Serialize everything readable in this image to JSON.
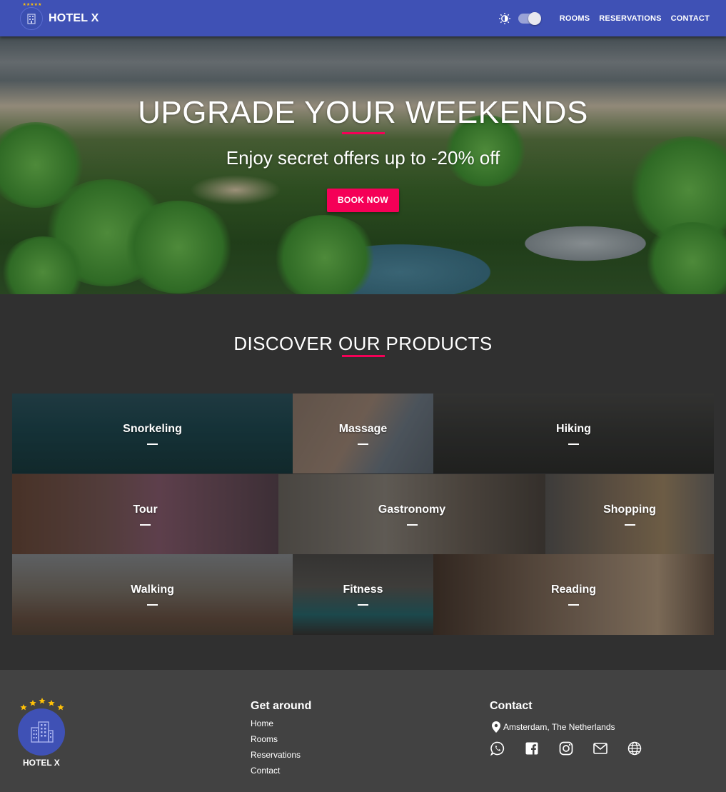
{
  "nav": {
    "brand": "HOTEL X",
    "links": [
      "ROOMS",
      "RESERVATIONS",
      "CONTACT"
    ],
    "theme_toggle_on": true,
    "bg_color": "#3f51b5"
  },
  "hero": {
    "title": "UPGRADE YOUR WEEKENDS",
    "subtitle": "Enjoy secret offers up to -20% off",
    "cta": "BOOK NOW",
    "accent_color": "#f50057"
  },
  "products": {
    "heading": "DISCOVER OUR PRODUCTS",
    "items": [
      "Snorkeling",
      "Massage",
      "Hiking",
      "Tour",
      "Gastronomy",
      "Shopping",
      "Walking",
      "Fitness",
      "Reading"
    ]
  },
  "footer": {
    "brand": "HOTEL X",
    "get_around": {
      "title": "Get around",
      "links": [
        "Home",
        "Rooms",
        "Reservations",
        "Contact"
      ]
    },
    "contact": {
      "title": "Contact",
      "address": "Amsterdam, The Netherlands",
      "icons": [
        "whatsapp-icon",
        "facebook-icon",
        "instagram-icon",
        "email-icon",
        "website-icon"
      ]
    }
  }
}
